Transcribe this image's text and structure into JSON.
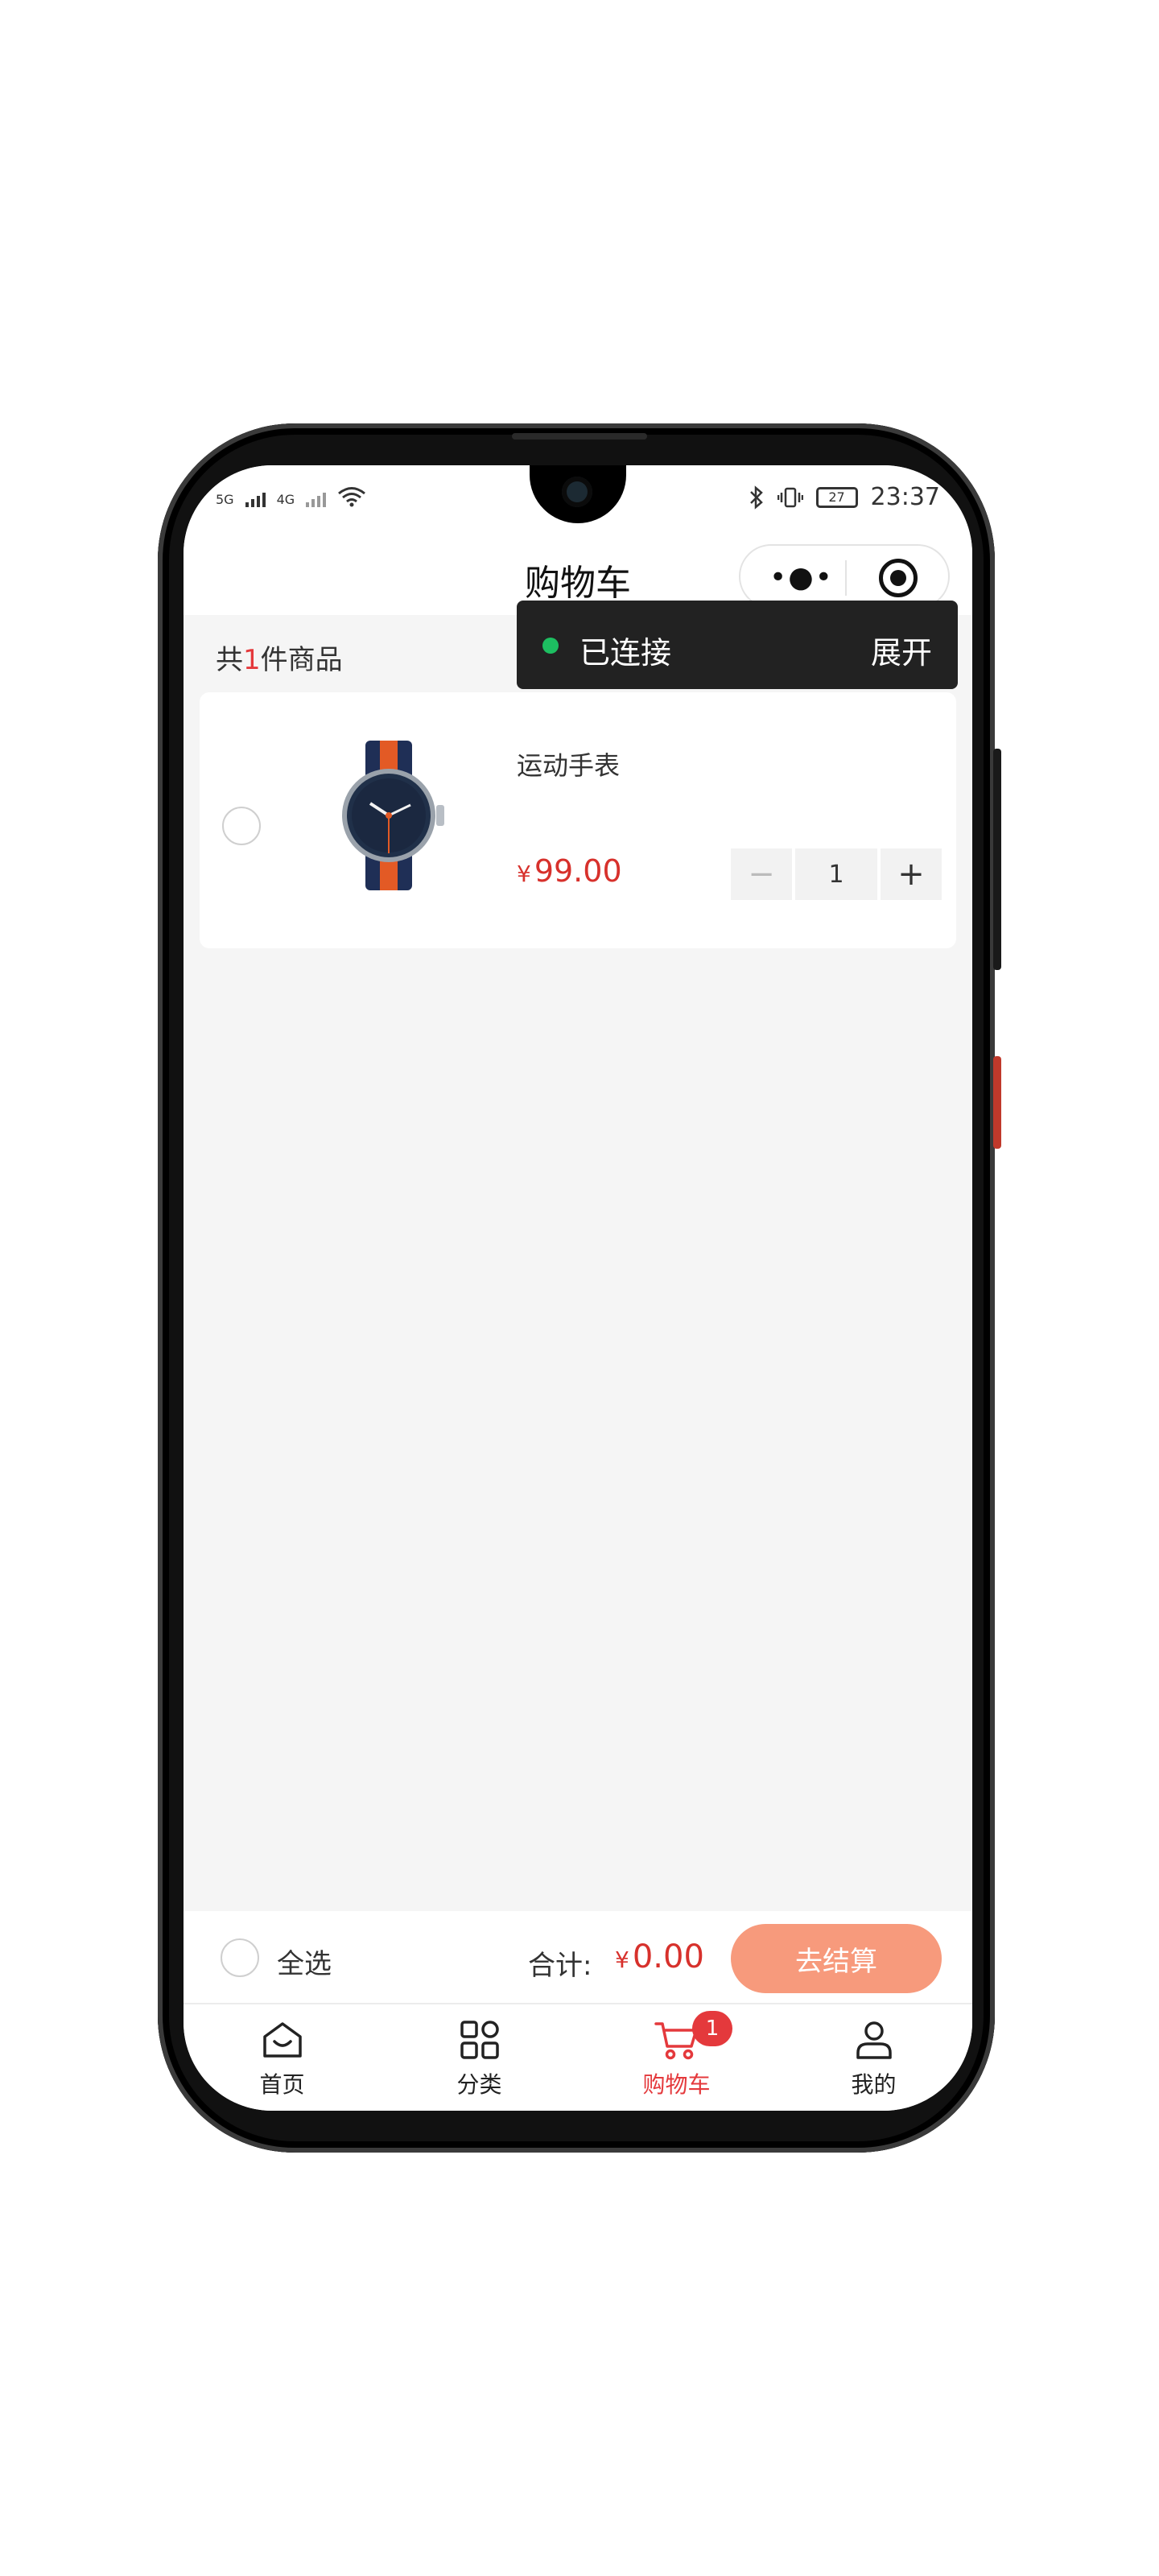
{
  "status_bar": {
    "network_left": "5G",
    "network_right": "4G",
    "battery": "27",
    "time": "23:37"
  },
  "navbar": {
    "title": "购物车"
  },
  "cart": {
    "count_prefix": "共",
    "count": "1",
    "count_suffix": "件商品"
  },
  "toast": {
    "label": "已连接",
    "action": "展开"
  },
  "items": [
    {
      "name": "运动手表",
      "currency": "¥",
      "price": "99.00",
      "quantity": "1",
      "minus": "−",
      "plus": "+"
    }
  ],
  "checkout": {
    "select_all": "全选",
    "total_label": "合计:",
    "currency": "¥",
    "total": "0.00",
    "button": "去结算"
  },
  "tabbar": {
    "items": [
      {
        "label": "首页",
        "icon": "home-icon"
      },
      {
        "label": "分类",
        "icon": "grid-icon"
      },
      {
        "label": "购物车",
        "icon": "cart-icon",
        "badge": "1",
        "active": true
      },
      {
        "label": "我的",
        "icon": "user-icon"
      }
    ]
  },
  "colors": {
    "accent": "#e4393c",
    "price": "#d7312c",
    "checkout_button": "#f79a7c",
    "connected_dot": "#1dbf61",
    "background": "#f5f5f5"
  }
}
